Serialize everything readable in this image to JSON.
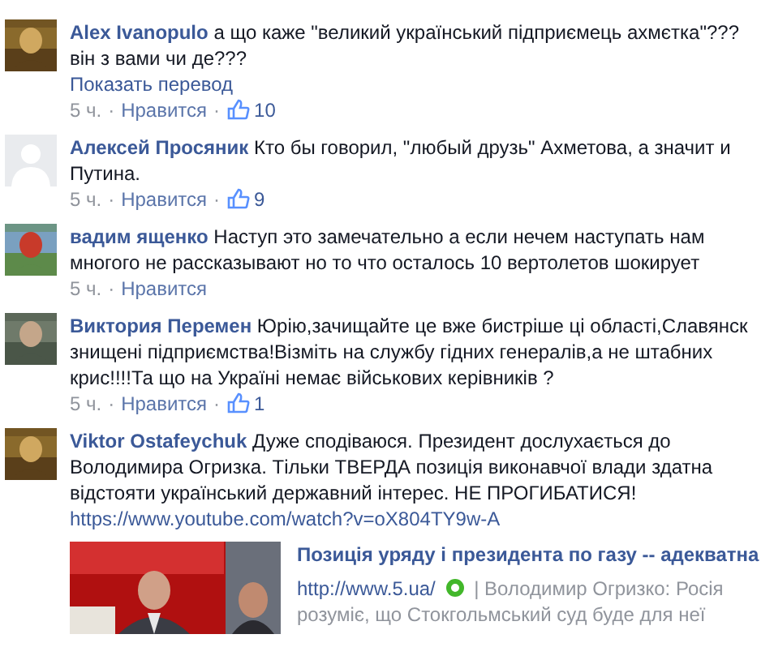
{
  "separator": "·",
  "comments": [
    {
      "author": "Alex Ivanopulo",
      "text": "а що каже \"великий український підприємець ахмєтка\"??? він з вами чи де???",
      "translate": "Показать перевод",
      "time": "5 ч.",
      "like": "Нравится",
      "likes": "10"
    },
    {
      "author": "Алексей Просяник",
      "avatar": {
        "kind": "silhouette"
      },
      "text": "Кто бы говорил, \"любый друзь\" Ахметова, а значит и Путина.",
      "time": "5 ч.",
      "like": "Нравится",
      "likes": "9"
    },
    {
      "author": "вадим ященко",
      "text": "Наступ это замечательно а если нечем наступать нам многого не рассказывают но то что осталось 10 вертолетов шокирует",
      "time": "5 ч.",
      "like": "Нравится"
    },
    {
      "author": "Виктория Перемен",
      "text": "Юрію,зачищайте це вже бистріше ці області,Славянск знищені підприємства!Візміть на службу гідних генералів,а не штабних крис!!!!Та що на Україні немає військових керівників ?",
      "time": "5 ч.",
      "like": "Нравится",
      "likes": "1"
    },
    {
      "author": "Viktor Ostafeychuk",
      "text": "Дуже сподіваюся. Президент дослухається до Володимира Огризка. Тільки ТВЕРДА позиція виконавчої влади здатна відстояти український державний інтерес. НЕ ПРОГИБАТИСЯ!",
      "link": "https://www.youtube.com/watch?v=oX804TY9w-A",
      "preview": {
        "title": "Позиція уряду і президента по газу -- адекватна",
        "url": "http://www.5.ua/",
        "description_lines": [
          "| Володимир Огризко: Росія",
          "розуміє, що Стокгольмський суд буде для неї"
        ]
      }
    }
  ]
}
